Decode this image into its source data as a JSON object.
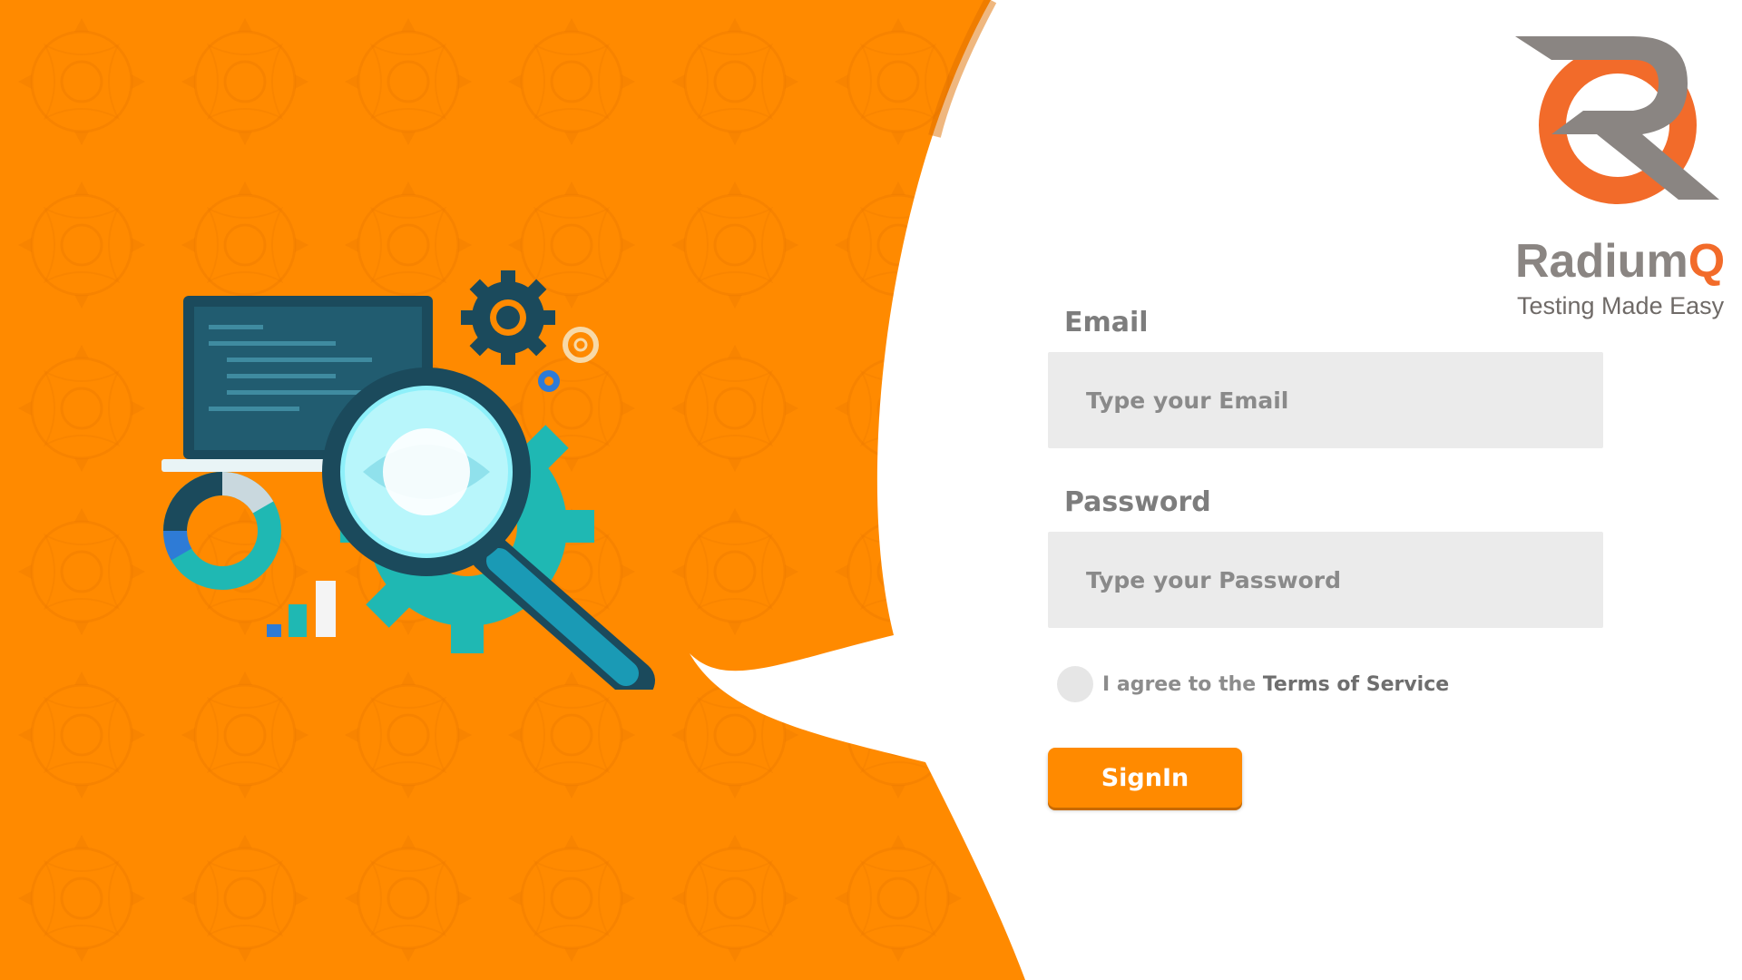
{
  "brand": {
    "name_main": "Radium",
    "name_accent": "Q",
    "tagline": "Testing Made Easy"
  },
  "form": {
    "email_label": "Email",
    "email_placeholder": "Type your Email",
    "email_value": "",
    "password_label": "Password",
    "password_placeholder": "Type your Password",
    "password_value": "",
    "agree_prefix": "I agree to the ",
    "agree_link": "Terms of Service",
    "agree_checked": false,
    "signin_label": "SignIn"
  },
  "colors": {
    "primary_orange": "#ff8a00",
    "logo_orange": "#f26b2a",
    "logo_gray": "#8a8582",
    "input_bg": "#ebebeb",
    "teal": "#1fb8b3",
    "navy": "#1b4a5c"
  },
  "icons": [
    "logo-r-mark",
    "gear-icon",
    "magnifier-icon",
    "laptop-icon",
    "donut-chart-icon",
    "bar-chart-icon"
  ]
}
